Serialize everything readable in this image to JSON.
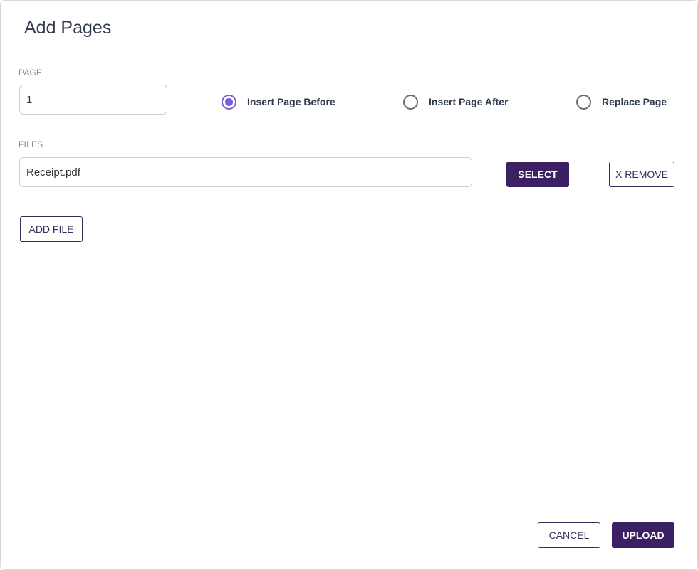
{
  "dialog": {
    "title": "Add Pages"
  },
  "page_section": {
    "label": "PAGE",
    "value": "1"
  },
  "position_options": [
    {
      "label": "Insert Page Before",
      "selected": true
    },
    {
      "label": "Insert Page After",
      "selected": false
    },
    {
      "label": "Replace Page",
      "selected": false
    }
  ],
  "files_section": {
    "label": "FILES",
    "file_name": "Receipt.pdf",
    "select_label": "SELECT",
    "remove_label": "X REMOVE",
    "add_file_label": "ADD FILE"
  },
  "footer": {
    "cancel_label": "CANCEL",
    "upload_label": "UPLOAD"
  },
  "colors": {
    "primary": "#3b2063",
    "radio_accent": "#7b5bd6",
    "title_text": "#2f3a4c"
  }
}
